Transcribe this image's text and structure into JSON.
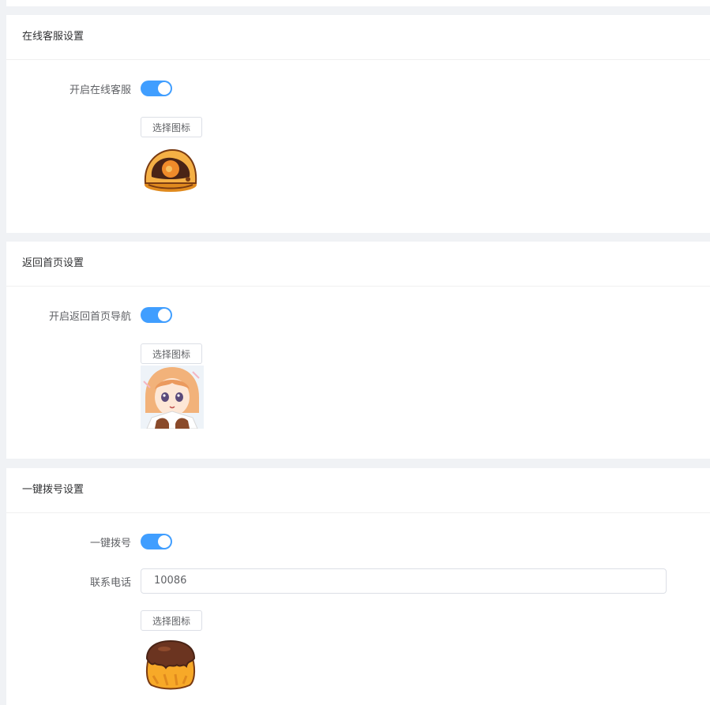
{
  "online_service": {
    "title": "在线客服设置",
    "toggle_label": "开启在线客服",
    "toggle_on": true,
    "choose_icon_label": "选择图标",
    "icon_name": "sweet-bun-icon"
  },
  "home_nav": {
    "title": "返回首页设置",
    "toggle_label": "开启返回首页导航",
    "toggle_on": true,
    "choose_icon_label": "选择图标",
    "icon_name": "anime-girl-avatar"
  },
  "one_click_call": {
    "title": "一键拨号设置",
    "toggle_label": "一键拨号",
    "toggle_on": true,
    "phone_label": "联系电话",
    "phone_value": "10086",
    "choose_icon_label": "选择图标",
    "icon_name": "pudding-icon"
  },
  "colors": {
    "accent": "#409eff",
    "page_bg": "#f0f2f5"
  }
}
